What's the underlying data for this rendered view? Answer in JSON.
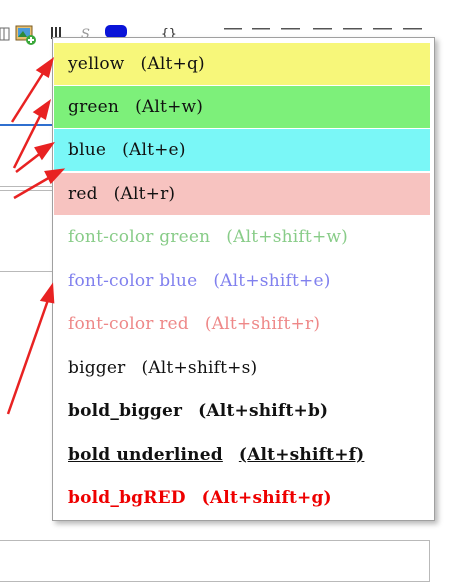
{
  "colors": {
    "yellow_bg": "#f7f77a",
    "green_bg": "#7df07a",
    "blue_bg": "#7af7f7",
    "red_bg": "#f7c3c0",
    "font_green": "#88cc88",
    "font_blue": "#8080ee",
    "font_red": "#ee8888",
    "bold_red": "#ee0000",
    "arrow_red": "#e82222"
  },
  "toolbar": {
    "icons": [
      "table-icon",
      "insert-image-icon",
      "strike-icon",
      "color-swatch-icon",
      "braces-icon",
      "numbered-list-icon",
      "bulleted-list-icon",
      "align-left-icon",
      "align-center-icon",
      "align-right-icon",
      "align-justify-icon"
    ]
  },
  "menu": {
    "items": [
      {
        "label": "yellow",
        "shortcut": "(Alt+q)"
      },
      {
        "label": "green",
        "shortcut": "(Alt+w)"
      },
      {
        "label": "blue",
        "shortcut": "(Alt+e)"
      },
      {
        "label": "red",
        "shortcut": "(Alt+r)"
      },
      {
        "label": "font-color green",
        "shortcut": "(Alt+shift+w)"
      },
      {
        "label": "font-color blue",
        "shortcut": "(Alt+shift+e)"
      },
      {
        "label": "font-color red",
        "shortcut": "(Alt+shift+r)"
      },
      {
        "label": "bigger",
        "shortcut": "(Alt+shift+s)"
      },
      {
        "label": "bold_bigger",
        "shortcut": "(Alt+shift+b)"
      },
      {
        "label": "bold underlined",
        "shortcut": "(Alt+shift+f)"
      },
      {
        "label": "bold_bgRED",
        "shortcut": "(Alt+shift+g)"
      }
    ]
  }
}
